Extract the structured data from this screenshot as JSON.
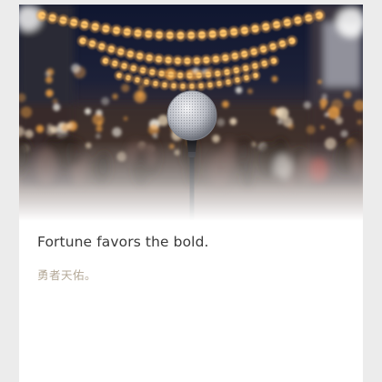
{
  "card": {
    "image": {
      "subject": "microphone-on-stand-bokeh-string-lights",
      "colors": {
        "night_sky": "#13192e",
        "bulb_glow": "#f5a646",
        "crowd_shadow": "#3b2a27",
        "fade_to": "#ffffff"
      }
    },
    "quote": "Fortune favors the bold.",
    "translation": "勇者天佑。"
  }
}
